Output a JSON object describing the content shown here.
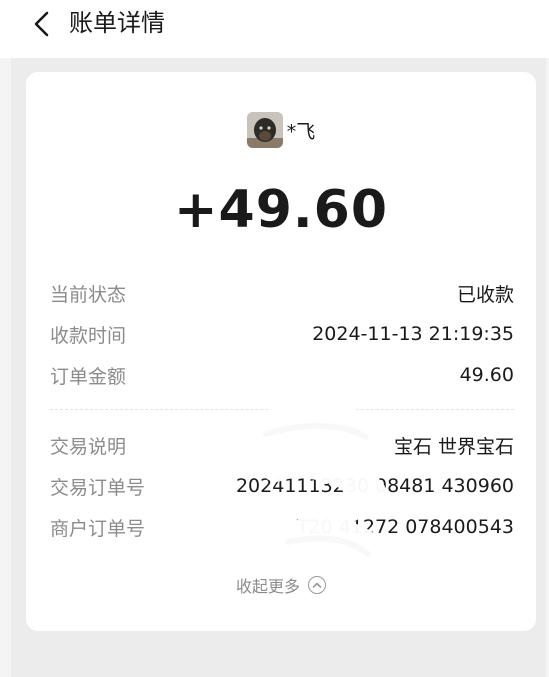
{
  "header": {
    "title": "账单详情",
    "back_icon": "chevron-left-icon"
  },
  "payer": {
    "name": "*飞",
    "avatar_icon": "avatar-photo"
  },
  "amount": "+49.60",
  "summary_rows": [
    {
      "label": "当前状态",
      "value": "已收款"
    },
    {
      "label": "收款时间",
      "value": "2024-11-13 21:19:35"
    },
    {
      "label": "订单金额",
      "value": "49.60"
    }
  ],
  "detail_rows": [
    {
      "label": "交易说明",
      "value": "宝石 世界宝石"
    },
    {
      "label": "交易订单号",
      "value": "20241113230 08481 430960"
    },
    {
      "label": "商户订单号",
      "value": "T20 41272 078400543"
    }
  ],
  "collapse": {
    "label": "收起更多",
    "icon": "chevron-up-circle-icon"
  },
  "colors": {
    "page_bg": "#f4f4f4",
    "card_bg": "#ffffff",
    "label_text": "#8c8c8c",
    "value_text": "#1a1a1a"
  }
}
